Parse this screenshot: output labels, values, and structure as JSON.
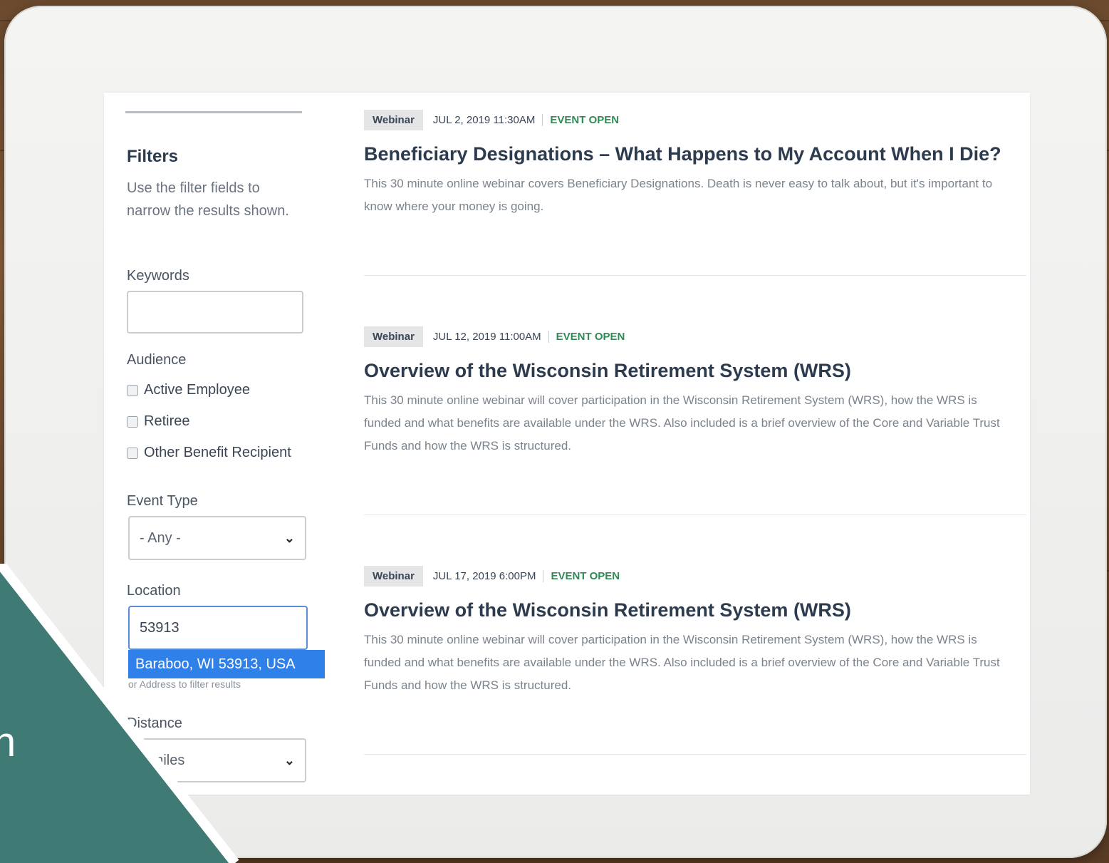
{
  "filters": {
    "title": "Filters",
    "description": "Use the filter fields to narrow the results shown.",
    "keywords_label": "Keywords",
    "keywords_value": "",
    "audience_label": "Audience",
    "audience_options": [
      "Active Employee",
      "Retiree",
      "Other Benefit Recipient"
    ],
    "event_type_label": "Event Type",
    "event_type_value": "- Any -",
    "location_label": "Location",
    "location_value": "53913",
    "location_suggestion": "Baraboo, WI 53913, USA",
    "location_help": "or Address to filter results",
    "distance_label": "Distance",
    "distance_value": "0 miles"
  },
  "events": [
    {
      "type": "Webinar",
      "date": "JUL 2, 2019 11:30AM",
      "status": "EVENT OPEN",
      "title": "Beneficiary Designations – What Happens to My Account When I Die?",
      "description": "This 30 minute online webinar covers Beneficiary Designations. Death is never easy to talk about, but it's important to know where your money is going."
    },
    {
      "type": "Webinar",
      "date": "JUL 12, 2019 11:00AM",
      "status": "EVENT OPEN",
      "title": "Overview of the Wisconsin Retirement System (WRS)",
      "description": "This 30 minute online webinar will cover participation in the Wisconsin Retirement System (WRS), how the WRS is funded and what benefits are available under the WRS. Also included is a brief overview of the Core and Variable Trust Funds and how the WRS is structured."
    },
    {
      "type": "Webinar",
      "date": "JUL 17, 2019 6:00PM",
      "status": "EVENT OPEN",
      "title": "Overview of the Wisconsin Retirement System (WRS)",
      "description": "This 30 minute online webinar will cover participation in the Wisconsin Retirement System (WRS), how the WRS is funded and what benefits are available under the WRS. Also included is a brief overview of the Core and Variable Trust Funds and how the WRS is structured."
    }
  ],
  "overlay": {
    "text": "n",
    "color": "#3f7a74"
  }
}
